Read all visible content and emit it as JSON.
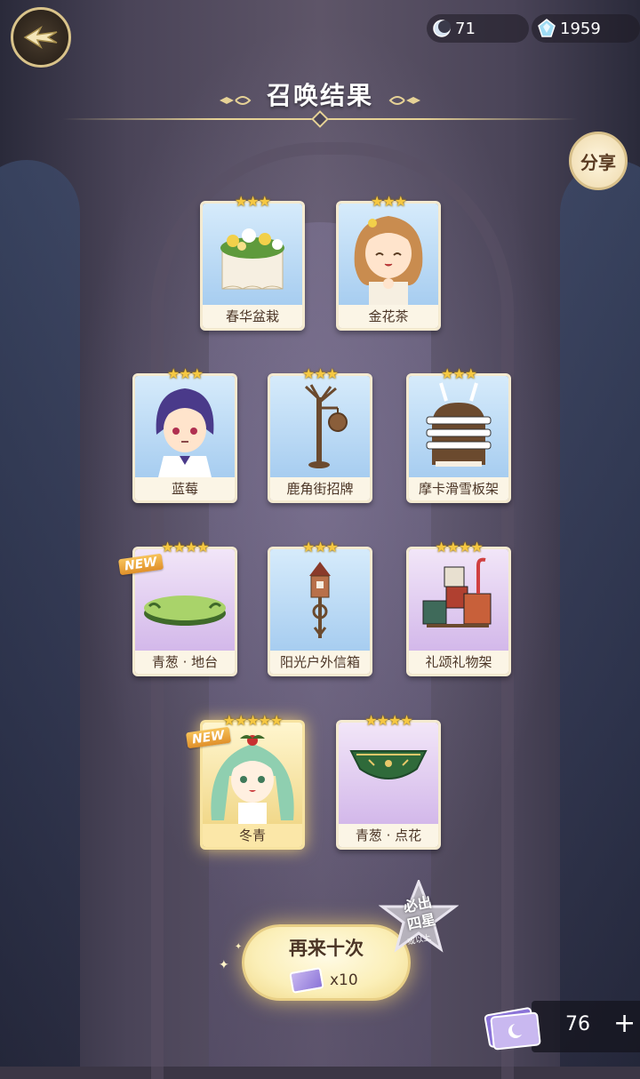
{
  "header": {
    "moon_currency": "71",
    "gem_currency": "1959",
    "title": "召唤结果",
    "share_label": "分享"
  },
  "results": [
    {
      "name": "春华盆栽",
      "stars": "★★★",
      "rarity": "blue",
      "is_new": false
    },
    {
      "name": "金花茶",
      "stars": "★★★",
      "rarity": "blue",
      "is_new": false
    },
    {
      "name": "蓝莓",
      "stars": "★★★",
      "rarity": "blue",
      "is_new": false
    },
    {
      "name": "鹿角街招牌",
      "stars": "★★★",
      "rarity": "blue",
      "is_new": false
    },
    {
      "name": "摩卡滑雪板架",
      "stars": "★★★",
      "rarity": "blue",
      "is_new": false
    },
    {
      "name": "青葱 · 地台",
      "stars": "★★★★",
      "rarity": "purple",
      "is_new": true
    },
    {
      "name": "阳光户外信箱",
      "stars": "★★★",
      "rarity": "blue",
      "is_new": false
    },
    {
      "name": "礼颂礼物架",
      "stars": "★★★★",
      "rarity": "purple",
      "is_new": false
    },
    {
      "name": "冬青",
      "stars": "★★★★★",
      "rarity": "gold",
      "is_new": true
    },
    {
      "name": "青葱 · 点花",
      "stars": "★★★★",
      "rarity": "purple",
      "is_new": false
    }
  ],
  "new_tag": "NEW",
  "footer": {
    "again_label": "再来十次",
    "again_cost": "x10",
    "badge_text": "必出\n四星",
    "badge_sub": "或以上",
    "ticket_count": "76",
    "plus_label": "+"
  },
  "colors": {
    "card_blue": "#a7cdf0",
    "card_purple": "#d3b8ea",
    "card_gold": "#f1d88a",
    "star": "#f6c842",
    "accent_gold": "#e6d296"
  }
}
